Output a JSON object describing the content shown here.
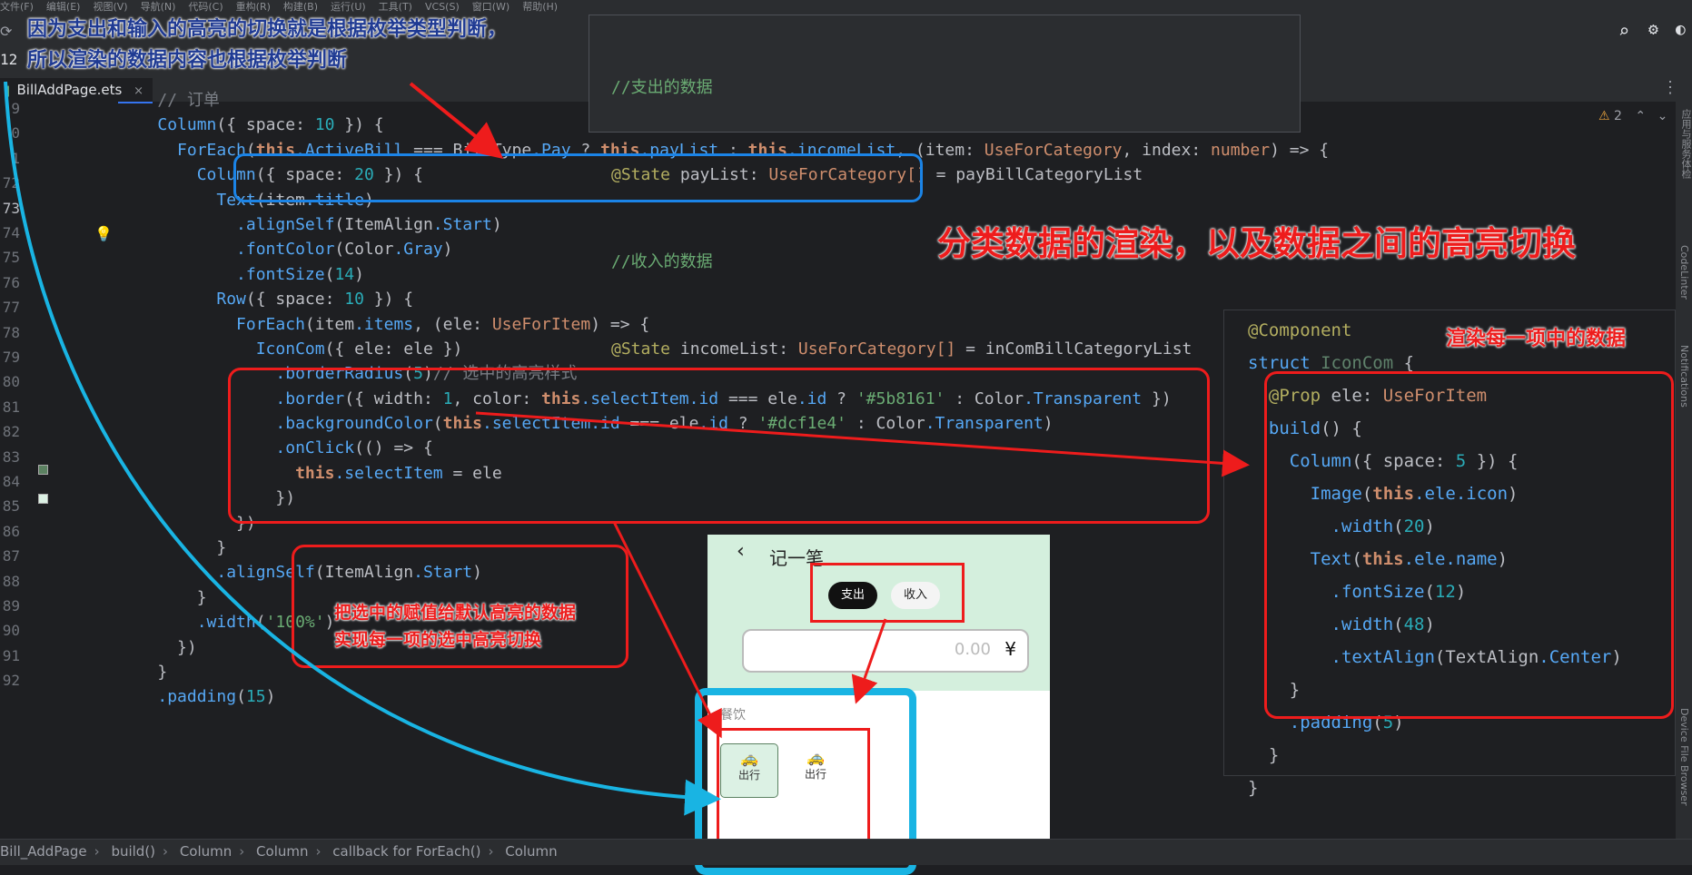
{
  "menubar": [
    "文件(F)",
    "编辑(E)",
    "视图(V)",
    "导航(N)",
    "代码(C)",
    "重构(R)",
    "构建(B)",
    "运行(U)",
    "工具(T)",
    "VCS(S)",
    "窗口(W)",
    "帮助(H)"
  ],
  "toolbar": {
    "badge": "12",
    "search_icon": "search-icon",
    "settings_icon": "gear-icon"
  },
  "tab": {
    "label": "BillAddPage.ets",
    "close": "×"
  },
  "warnings": {
    "count": "2",
    "icon": "warning-triangle-icon"
  },
  "line_numbers": [
    "9",
    "0",
    "1",
    "72",
    "73",
    "74",
    "75",
    "76",
    "77",
    "78",
    "79",
    "80",
    "81",
    "82",
    "83",
    "84",
    "85",
    "86",
    "87",
    "88",
    "89",
    "90",
    "91",
    "92"
  ],
  "code_lines": [
    {
      "t": "    // 订单"
    },
    {
      "t": "    Column({ space: 10 }) {"
    },
    {
      "t": "      ForEach(this.ActiveBill === BillType.Pay ? this.payList : this.incomeList, (item: UseForCategory, index: number) => {"
    },
    {
      "t": "        Column({ space: 20 }) {"
    },
    {
      "t": "          Text(item.title)"
    },
    {
      "t": "            .alignSelf(ItemAlign.Start)"
    },
    {
      "t": "            .fontColor(Color.Gray)"
    },
    {
      "t": "            .fontSize(14)"
    },
    {
      "t": "          Row({ space: 10 }) {"
    },
    {
      "t": "            ForEach(item.items, (ele: UseForItem) => {"
    },
    {
      "t": "              IconCom({ ele: ele })"
    },
    {
      "t": "                .borderRadius(5)// 选中的高亮样式"
    },
    {
      "t": "                .border({ width: 1, color: this.selectItem.id === ele.id ? '#5b8161' : Color.Transparent })"
    },
    {
      "t": "                .backgroundColor(this.selectItem.id === ele.id ? '#dcf1e4' : Color.Transparent)"
    },
    {
      "t": "                .onClick(() => {"
    },
    {
      "t": "                  this.selectItem = ele"
    },
    {
      "t": "                })"
    },
    {
      "t": "            })"
    },
    {
      "t": "          }"
    },
    {
      "t": "          .alignSelf(ItemAlign.Start)"
    },
    {
      "t": "        }"
    },
    {
      "t": "        .width('100%')"
    },
    {
      "t": "      })"
    },
    {
      "t": "    }"
    },
    {
      "t": "    .padding(15)"
    }
  ],
  "popup_top": {
    "lines": [
      "//支出的数据",
      "@State payList: UseForCategory[] = payBillCategoryList",
      "//收入的数据",
      "@State incomeList: UseForCategory[] = inComBillCategoryList"
    ]
  },
  "popup_right": {
    "lines": [
      "@Component",
      "struct IconCom {",
      "  @Prop ele: UseForItem",
      "  build() {",
      "    Column({ space: 5 }) {",
      "      Image(this.ele.icon)",
      "        .width(20)",
      "      Text(this.ele.name)",
      "        .fontSize(12)",
      "        .width(48)",
      "        .textAlign(TextAlign.Center)",
      "    }",
      "    .padding(5)",
      "  }",
      "}"
    ]
  },
  "annotations": {
    "blue_top": "因为支出和输入的高亮的切换就是根据枚举类型判断，",
    "blue_top2": "所以渲染的数据内容也根据枚举判断",
    "red_center": "分类数据的渲染，以及数据之间的高亮切换",
    "red_right": "渲染每一项中的数据",
    "red_mid1": "把选中的赋值给默认高亮的数据",
    "red_mid2": "实现每一项的选中高亮切换"
  },
  "phone": {
    "back": "‹",
    "title": "记一笔",
    "tab_pay": "支出",
    "tab_income": "收入",
    "amount_placeholder": "0.00",
    "currency": "¥",
    "category": "餐饮",
    "items": [
      {
        "icon": "taxi-icon",
        "label": "出行",
        "selected": true
      },
      {
        "icon": "taxi-icon",
        "label": "出行",
        "selected": false
      }
    ]
  },
  "breadcrumb": [
    "Bill_AddPage",
    "build()",
    "Column",
    "Column",
    "callback for ForEach()",
    "Column"
  ],
  "right_strip": [
    "应用与服务体检",
    "CodeLinter",
    "Notifications",
    "Device File Browser"
  ]
}
